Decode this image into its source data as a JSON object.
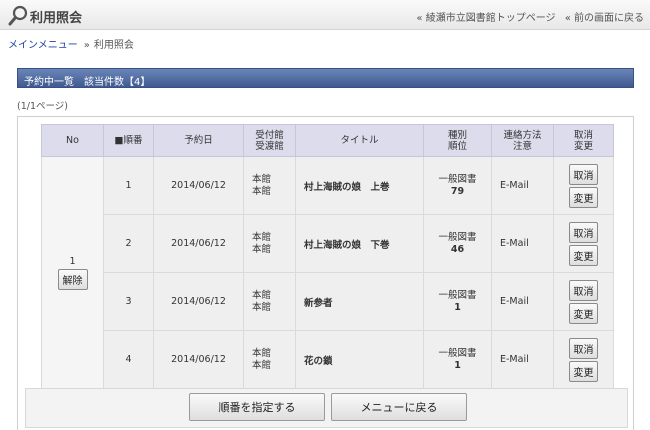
{
  "header": {
    "title": "利用照会",
    "links": [
      "« 綾瀬市立図書館トップページ",
      "« 前の画面に戻る"
    ]
  },
  "breadcrumb": {
    "home": "メインメニュー",
    "separator": "»",
    "current": "利用照会"
  },
  "section": {
    "title": "予約中一覧　該当件数【4】",
    "page_info": "(1/1ページ)"
  },
  "table": {
    "headers": {
      "no": "No",
      "order": "■順番",
      "date": "予約日",
      "branch_1": "受付館",
      "branch_2": "受渡館",
      "title": "タイトル",
      "type_1": "種別",
      "type_2": "順位",
      "contact_1": "連絡方法",
      "contact_2": "注意",
      "cancel_1": "取消",
      "cancel_2": "変更"
    },
    "group_no": "1",
    "release_label": "解除",
    "cancel_label": "取消",
    "change_label": "変更",
    "rows": [
      {
        "order": "1",
        "date": "2014/06/12",
        "branch_a": "本館",
        "branch_b": "本館",
        "title": "村上海賊の娘　上巻",
        "type": "一般図書",
        "rank": "79",
        "contact": "E-Mail"
      },
      {
        "order": "2",
        "date": "2014/06/12",
        "branch_a": "本館",
        "branch_b": "本館",
        "title": "村上海賊の娘　下巻",
        "type": "一般図書",
        "rank": "46",
        "contact": "E-Mail"
      },
      {
        "order": "3",
        "date": "2014/06/12",
        "branch_a": "本館",
        "branch_b": "本館",
        "title": "新参者",
        "type": "一般図書",
        "rank": "1",
        "contact": "E-Mail"
      },
      {
        "order": "4",
        "date": "2014/06/12",
        "branch_a": "本館",
        "branch_b": "本館",
        "title": "花の鎖",
        "type": "一般図書",
        "rank": "1",
        "contact": "E-Mail"
      }
    ]
  },
  "footer": {
    "specify_order": "順番を指定する",
    "back_to_menu": "メニューに戻る"
  },
  "icons": {
    "logo": "magnifier-icon"
  },
  "colors": {
    "header_blue": "#3f5a90",
    "link_blue": "#1a3ea8"
  }
}
